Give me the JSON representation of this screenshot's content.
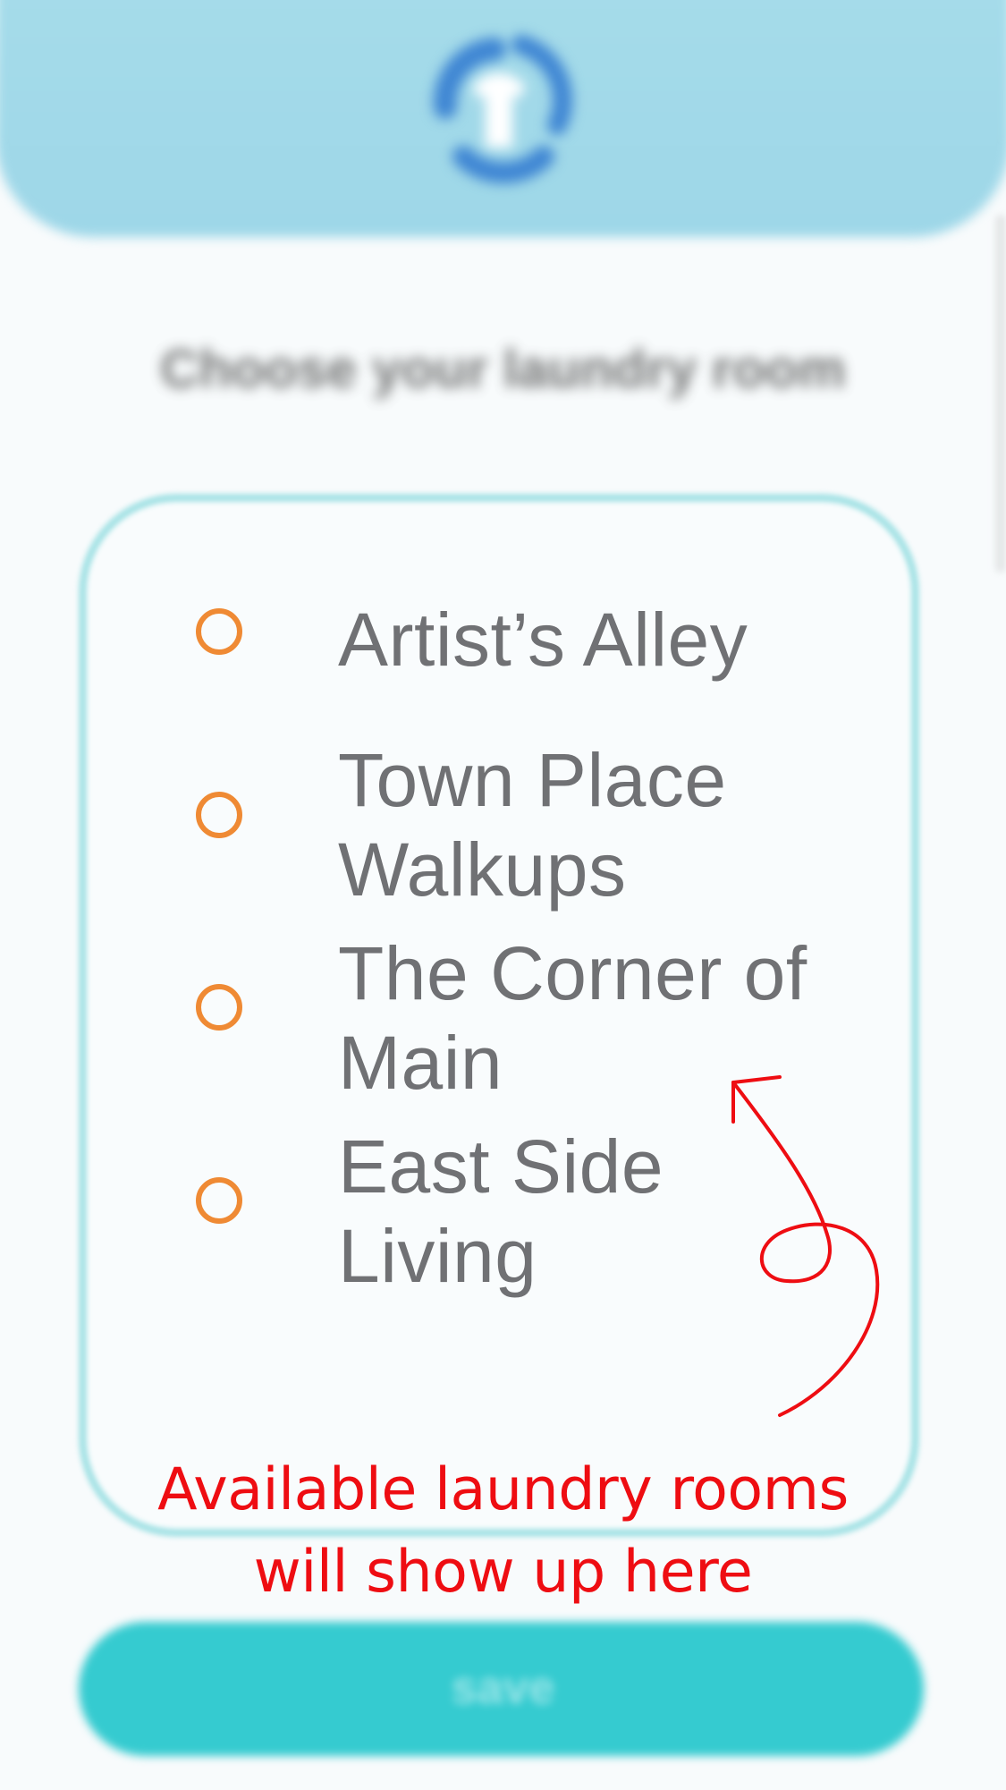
{
  "header": {
    "logo_icon": "laundry-shirt-swirl-icon"
  },
  "page_title": "Choose your laundry room",
  "rooms": [
    {
      "label_line1": "Artist’s Alley",
      "label_line2": ""
    },
    {
      "label_line1": "Town Place",
      "label_line2": "Walkups"
    },
    {
      "label_line1": "The Corner of",
      "label_line2": "Main"
    },
    {
      "label_line1": "East Side",
      "label_line2": "Living"
    }
  ],
  "annotation": {
    "line1": "Available laundry rooms",
    "line2": "will show up here",
    "color": "#ee0d12"
  },
  "save_button": {
    "label": "SAVE"
  },
  "colors": {
    "header": "#a6dcea",
    "accent_orange": "#ef8a34",
    "card_border": "#a8e3e6",
    "button": "#35cbd0",
    "room_text": "#707174"
  }
}
